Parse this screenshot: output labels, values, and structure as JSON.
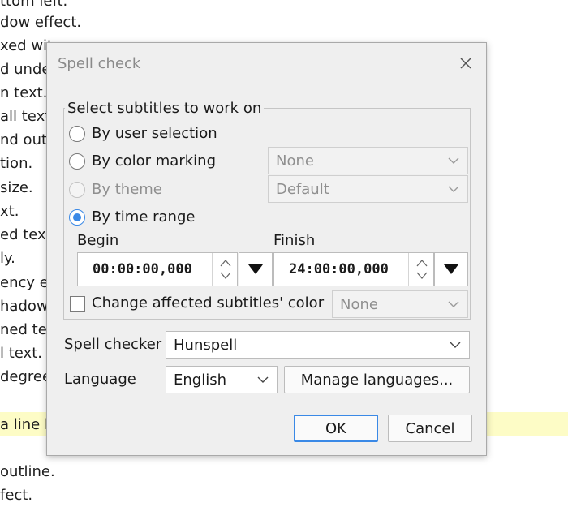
{
  "background": {
    "lines": [
      "ttom left.",
      "dow effect.",
      "xed wit",
      "d unde",
      "n text.",
      "all text.",
      "nd out",
      "tion.",
      "size.",
      "xt.",
      "ed text",
      "ly.",
      "ency ef",
      "hadow",
      "ned tex",
      "l text.",
      "degree",
      "",
      "a line b",
      "",
      "outline.",
      "fect."
    ]
  },
  "dialog": {
    "title": "Spell check",
    "close_icon": "close-icon",
    "group": {
      "title": "Select subtitles to work on",
      "options": {
        "user_selection": "By user selection",
        "color_marking": "By color marking",
        "theme": "By theme",
        "time_range": "By time range"
      },
      "selected": "time_range",
      "color_marking_value": "None",
      "theme_value": "Default",
      "begin_label": "Begin",
      "finish_label": "Finish",
      "begin_value": "00:00:00,000",
      "finish_value": "24:00:00,000",
      "change_color_label": "Change affected subtitles' color",
      "change_color_value": "None",
      "change_color_checked": false
    },
    "spell_checker_label": "Spell checker",
    "spell_checker_value": "Hunspell",
    "language_label": "Language",
    "language_value": "English",
    "manage_languages_label": "Manage languages...",
    "ok_label": "OK",
    "cancel_label": "Cancel"
  },
  "colors": {
    "accent": "#3a89e6",
    "highlight": "#fdfcc6"
  }
}
